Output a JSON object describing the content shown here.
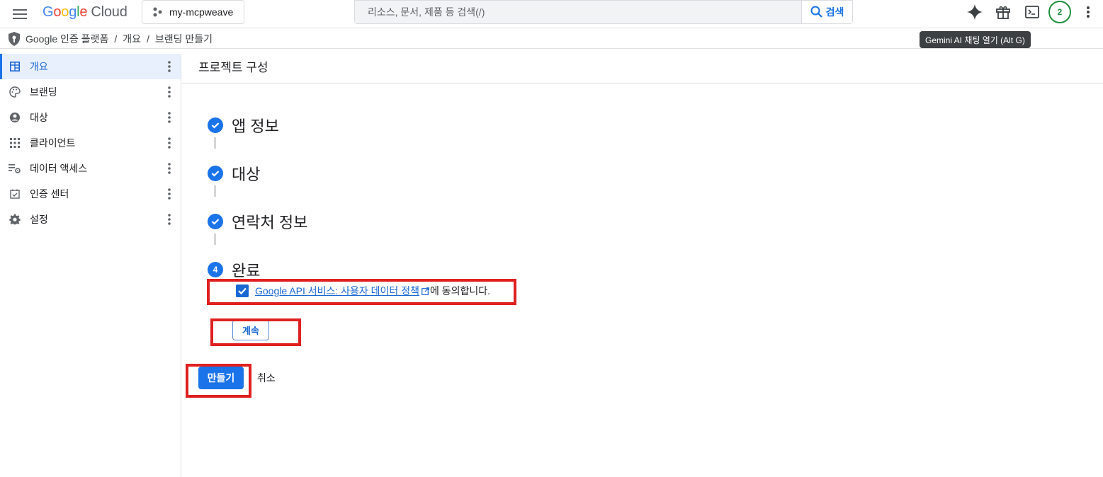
{
  "topbar": {
    "logo_letters": [
      "G",
      "o",
      "o",
      "g",
      "l",
      "e"
    ],
    "logo_product": "Cloud",
    "project_name": "my-mcpweave",
    "search_placeholder": "리소스, 문서, 제품 등 검색(/)",
    "search_button": "검색",
    "avatar_initial": "2"
  },
  "tooltip": "Gemini AI 채팅 열기 (Alt G)",
  "breadcrumb": {
    "product": "Google 인증 플랫폼",
    "items": [
      "개요",
      "브랜딩 만들기"
    ]
  },
  "sidebar": {
    "items": [
      {
        "label": "개요",
        "icon": "dashboard-icon",
        "active": true
      },
      {
        "label": "브랜딩",
        "icon": "palette-icon",
        "active": false
      },
      {
        "label": "대상",
        "icon": "person-icon",
        "active": false
      },
      {
        "label": "클라이언트",
        "icon": "apps-grid-icon",
        "active": false
      },
      {
        "label": "데이터 액세스",
        "icon": "data-access-icon",
        "active": false
      },
      {
        "label": "인증 센터",
        "icon": "verified-icon",
        "active": false
      },
      {
        "label": "설정",
        "icon": "gear-icon",
        "active": false
      }
    ]
  },
  "main": {
    "title": "프로젝트 구성",
    "steps": [
      {
        "title": "앱 정보",
        "state": "done"
      },
      {
        "title": "대상",
        "state": "done"
      },
      {
        "title": "연락처 정보",
        "state": "done"
      },
      {
        "title": "완료",
        "state": "current",
        "number": "4"
      }
    ],
    "consent": {
      "checked": true,
      "link_text": "Google API 서비스: 사용자 데이터 정책",
      "tail_text": "에 동의합니다."
    },
    "continue_label": "계속",
    "create_label": "만들기",
    "cancel_label": "취소"
  },
  "colors": {
    "primary": "#1a73e8",
    "highlight": "#e02020",
    "avatar_ring": "#1e8e3e"
  }
}
